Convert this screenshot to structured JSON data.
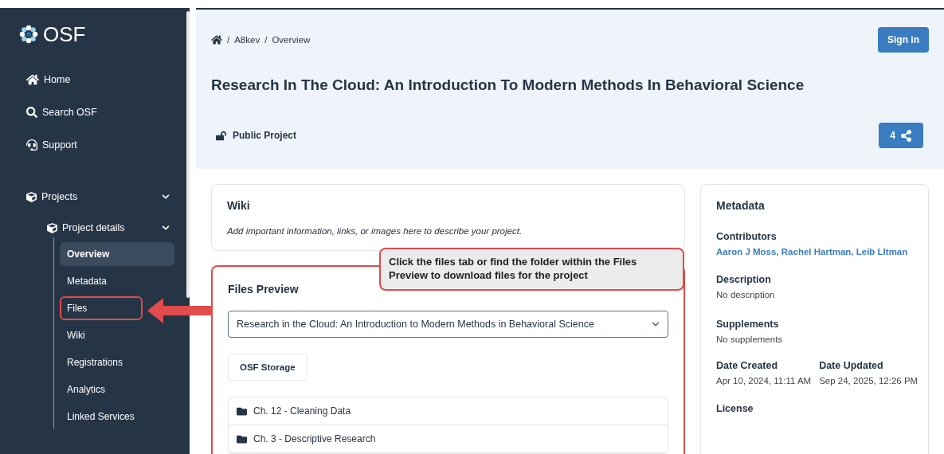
{
  "sidebar": {
    "logo": "OSF",
    "nav": [
      {
        "label": "Home",
        "kind": "home"
      },
      {
        "label": "Search OSF",
        "kind": "search"
      },
      {
        "label": "Support",
        "kind": "support"
      }
    ],
    "projects": {
      "label": "Projects",
      "expanded": true,
      "details": {
        "label": "Project details",
        "expanded": true,
        "items": [
          {
            "label": "Overview",
            "selected": true,
            "highlighted": false
          },
          {
            "label": "Metadata",
            "selected": false,
            "highlighted": false
          },
          {
            "label": "Files",
            "selected": false,
            "highlighted": true
          },
          {
            "label": "Wiki",
            "selected": false,
            "highlighted": false
          },
          {
            "label": "Registrations",
            "selected": false,
            "highlighted": false
          },
          {
            "label": "Analytics",
            "selected": false,
            "highlighted": false
          },
          {
            "label": "Linked Services",
            "selected": false,
            "highlighted": false
          }
        ]
      }
    }
  },
  "header": {
    "breadcrumb": {
      "separator": "/",
      "items": [
        "A8kev",
        "Overview"
      ]
    },
    "sign_in": "Sign in",
    "title": "Research In The Cloud: An Introduction To Modern Methods In Behavioral Science",
    "visibility": "Public Project",
    "share_count": "4"
  },
  "wiki": {
    "title": "Wiki",
    "text": "Add important information, links, or images here to describe your project."
  },
  "files_preview": {
    "title": "Files Preview",
    "highlighted": true,
    "project_select": "Research in the Cloud: An Introduction to Modern Methods in Behavioral Science",
    "storage": "OSF Storage",
    "folders": [
      "Ch. 12 - Cleaning Data",
      "Ch. 3 - Descriptive Research"
    ]
  },
  "callout": "Click the files tab or find the folder within the Files Preview to download files for the project",
  "metadata": {
    "title": "Metadata",
    "contributors": {
      "label": "Contributors",
      "value": "Aaron J Moss, Rachel Hartman, Leib LItman"
    },
    "description": {
      "label": "Description",
      "value": "No description"
    },
    "supplements": {
      "label": "Supplements",
      "value": "No supplements"
    },
    "dates": [
      {
        "label": "Date Created",
        "value": "Apr 10, 2024, 11:11 AM"
      },
      {
        "label": "Date Updated",
        "value": "Sep 24, 2025, 12:26 PM"
      }
    ],
    "license": {
      "label": "License"
    }
  }
}
